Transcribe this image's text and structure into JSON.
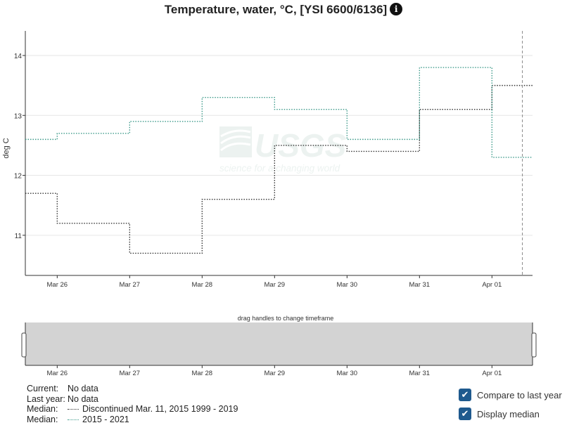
{
  "title": "Temperature, water, °C, [YSI 6600/6136]",
  "info_icon": "info-circle-icon",
  "chart_data": {
    "type": "line",
    "title": "Temperature, water, °C, [YSI 6600/6136]",
    "ylabel": "deg C",
    "xlabel": "",
    "x_ticks": [
      "Mar 26",
      "Mar 27",
      "Mar 28",
      "Mar 29",
      "Mar 30",
      "Mar 31",
      "Apr 01"
    ],
    "y_ticks": [
      11,
      12,
      13,
      14
    ],
    "xlim": [
      -0.44,
      6.56
    ],
    "ylim": [
      10.33,
      14.41
    ],
    "now_marker_x": 6.42,
    "grid": true,
    "step": true,
    "series": [
      {
        "name": "Median: Discontinued Mar. 11, 2015 1999 - 2019",
        "color": "#333333",
        "x": [
          -0.44,
          0,
          1,
          2,
          3,
          4,
          5,
          6,
          6.56
        ],
        "y": [
          11.7,
          11.2,
          10.7,
          11.6,
          12.5,
          12.4,
          13.1,
          13.5,
          13.5
        ]
      },
      {
        "name": "Median: 2015 - 2021",
        "color": "#3d9a8a",
        "x": [
          -0.44,
          0,
          1,
          2,
          3,
          4,
          5,
          6,
          6.56
        ],
        "y": [
          12.6,
          12.7,
          12.9,
          13.3,
          13.1,
          12.6,
          13.8,
          12.3,
          12.3
        ]
      }
    ]
  },
  "brush": {
    "label": "drag handles to change timeframe",
    "ticks": [
      "Mar 26",
      "Mar 27",
      "Mar 28",
      "Mar 29",
      "Mar 30",
      "Mar 31",
      "Apr 01"
    ]
  },
  "watermark": {
    "logo": "USGS",
    "tagline": "science for a changing world"
  },
  "legend": {
    "current_label": "Current:",
    "current_value": "No data",
    "last_year_label": "Last year:",
    "last_year_value": "No data",
    "median1_label": "Median:",
    "median1_value": "Discontinued Mar. 11, 2015 1999 - 2019",
    "median2_label": "Median:",
    "median2_value": "2015 - 2021"
  },
  "options": {
    "compare_label": "Compare to last year",
    "compare_checked": true,
    "median_label": "Display median",
    "median_checked": true
  }
}
